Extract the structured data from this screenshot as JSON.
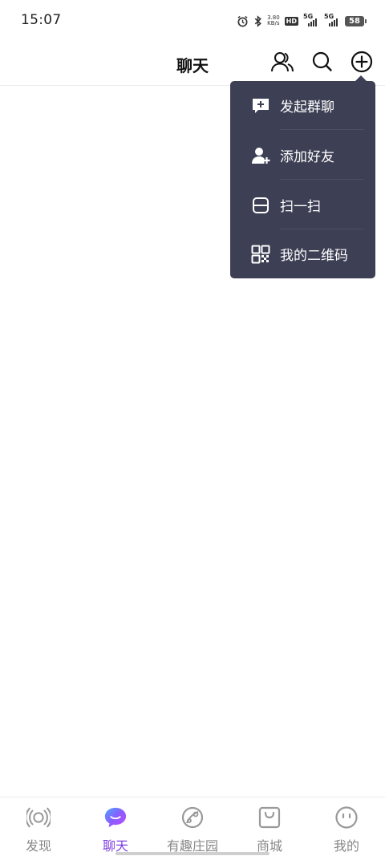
{
  "status_bar": {
    "time": "15:07",
    "net_speed_value": "3.80",
    "net_speed_unit": "KB/s",
    "hd_label": "HD",
    "sim1_network": "5G",
    "sim2_network": "5G",
    "battery": "58"
  },
  "header": {
    "title": "聊天"
  },
  "popup_menu": {
    "items": [
      {
        "label": "发起群聊",
        "icon": "group-chat-add-icon"
      },
      {
        "label": "添加好友",
        "icon": "add-friend-icon"
      },
      {
        "label": "扫一扫",
        "icon": "scan-icon"
      },
      {
        "label": "我的二维码",
        "icon": "qr-code-icon"
      }
    ]
  },
  "bottom_nav": {
    "items": [
      {
        "label": "发现",
        "icon": "discover-icon",
        "active": false
      },
      {
        "label": "聊天",
        "icon": "chat-bubble-icon",
        "active": true
      },
      {
        "label": "有趣庄园",
        "icon": "planet-icon",
        "active": false
      },
      {
        "label": "商城",
        "icon": "shopping-bag-icon",
        "active": false
      },
      {
        "label": "我的",
        "icon": "profile-face-icon",
        "active": false
      }
    ]
  },
  "colors": {
    "accent": "#7f3fe0",
    "popup_bg": "#3d3f54",
    "inactive": "#888888"
  }
}
